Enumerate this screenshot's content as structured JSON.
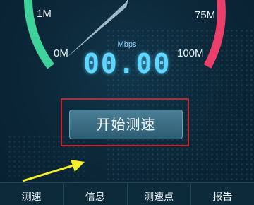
{
  "gauge": {
    "ticks": [
      {
        "label": "1M"
      },
      {
        "label": "0M"
      },
      {
        "label": "75M"
      },
      {
        "label": "100M"
      }
    ],
    "unit": "Mbps",
    "speed_display": "00.00",
    "colors": {
      "low_arc": "#3ed39a",
      "high_arc": "#ea3f6a",
      "needle": "#dce9f0"
    }
  },
  "start_button": {
    "label": "开始测速"
  },
  "annotation": {
    "highlight_color": "#c8232c",
    "arrow_color": "#f2ef2a"
  },
  "nav": {
    "items": [
      {
        "label": "测速"
      },
      {
        "label": "信息"
      },
      {
        "label": "测速点"
      },
      {
        "label": "报告"
      }
    ]
  }
}
